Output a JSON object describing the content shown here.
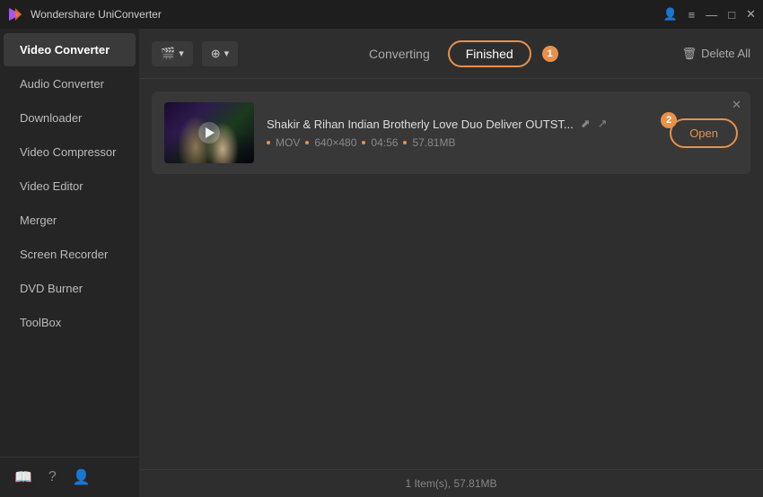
{
  "app": {
    "title": "Wondershare UniConverter",
    "logo_symbol": "▶"
  },
  "titlebar": {
    "account_icon": "👤",
    "menu_icon": "≡",
    "minimize_icon": "—",
    "maximize_icon": "□",
    "close_icon": "✕"
  },
  "sidebar": {
    "items": [
      {
        "id": "video-converter",
        "label": "Video Converter",
        "active": true
      },
      {
        "id": "audio-converter",
        "label": "Audio Converter",
        "active": false
      },
      {
        "id": "downloader",
        "label": "Downloader",
        "active": false
      },
      {
        "id": "video-compressor",
        "label": "Video Compressor",
        "active": false
      },
      {
        "id": "video-editor",
        "label": "Video Editor",
        "active": false
      },
      {
        "id": "merger",
        "label": "Merger",
        "active": false
      },
      {
        "id": "screen-recorder",
        "label": "Screen Recorder",
        "active": false
      },
      {
        "id": "dvd-burner",
        "label": "DVD Burner",
        "active": false
      },
      {
        "id": "toolbox",
        "label": "ToolBox",
        "active": false
      }
    ],
    "footer_icons": [
      "book",
      "question",
      "person"
    ]
  },
  "toolbar": {
    "add_file_label": "＋ ▾",
    "add_format_label": "⊕ ▾",
    "tab_converting_label": "Converting",
    "tab_finished_label": "Finished",
    "finished_badge": "1",
    "delete_all_label": "Delete All",
    "delete_icon": "🗑"
  },
  "file": {
    "title": "Shakir & Rihan Indian Brotherly Love Duo Deliver OUTST...",
    "format": "MOV",
    "resolution": "640×480",
    "duration": "04:56",
    "size": "57.81MB",
    "open_label": "Open",
    "open_badge": "2",
    "close_symbol": "✕",
    "external_icon": "⬈",
    "share_icon": "↗"
  },
  "statusbar": {
    "text": "1 Item(s), 57.81MB"
  }
}
